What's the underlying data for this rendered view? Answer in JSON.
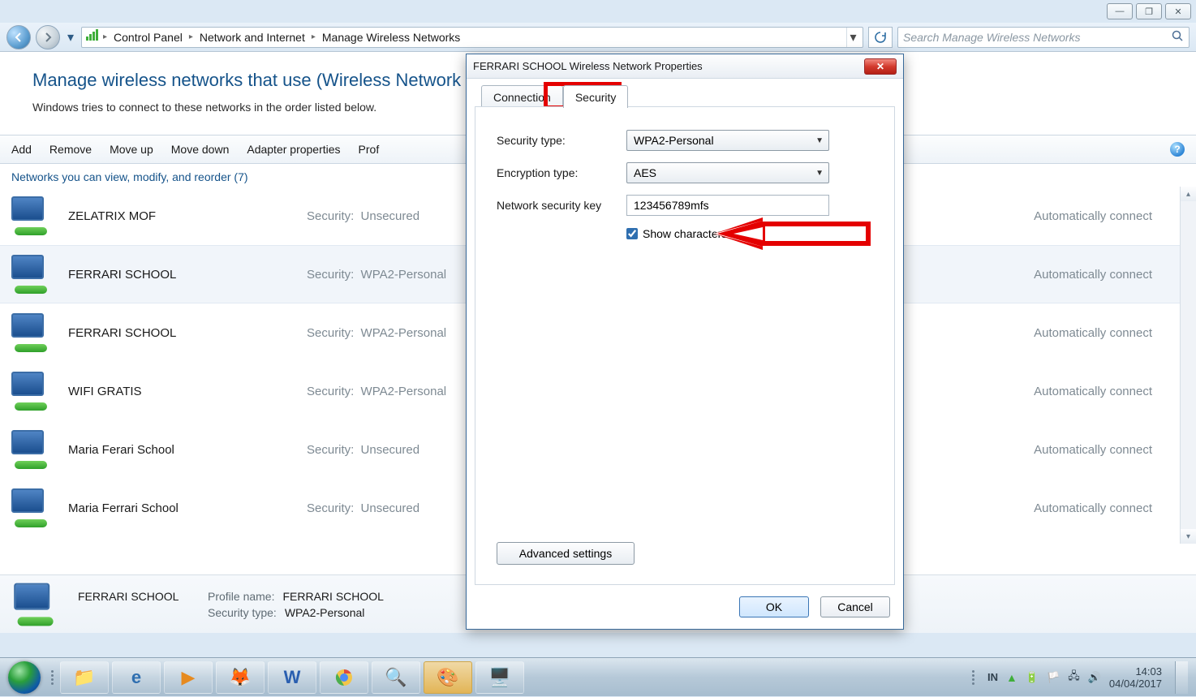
{
  "window_controls": {
    "minimize": "—",
    "maximize": "❐",
    "close": "✕"
  },
  "breadcrumbs": [
    "Control Panel",
    "Network and Internet",
    "Manage Wireless Networks"
  ],
  "search": {
    "placeholder": "Search Manage Wireless Networks"
  },
  "page": {
    "title": "Manage wireless networks that use (Wireless Network",
    "subtitle": "Windows tries to connect to these networks in the order listed below."
  },
  "toolbar": {
    "items": [
      "Add",
      "Remove",
      "Move up",
      "Move down",
      "Adapter properties",
      "Prof"
    ]
  },
  "group_header": "Networks you can view, modify, and reorder (7)",
  "security_label": "Security:",
  "auto_connect_label": "Automatically connect",
  "networks": [
    {
      "name": "ZELATRIX MOF",
      "security": "Unsecured",
      "selected": false
    },
    {
      "name": "FERRARI SCHOOL",
      "security": "WPA2-Personal",
      "selected": true
    },
    {
      "name": "FERRARI SCHOOL",
      "security": "WPA2-Personal",
      "selected": false
    },
    {
      "name": "WIFI GRATIS",
      "security": "WPA2-Personal",
      "selected": false
    },
    {
      "name": "Maria Ferari School",
      "security": "Unsecured",
      "selected": false
    },
    {
      "name": "Maria Ferrari School",
      "security": "Unsecured",
      "selected": false
    }
  ],
  "details": {
    "name": "FERRARI SCHOOL",
    "profile_label": "Profile name:",
    "profile_value": "FERRARI SCHOOL",
    "sectype_label": "Security type:",
    "sectype_value": "WPA2-Personal"
  },
  "dialog": {
    "title": "FERRARI SCHOOL  Wireless Network Properties",
    "tabs": {
      "connection": "Connection",
      "security": "Security"
    },
    "fields": {
      "sectype_label": "Security type:",
      "sectype_value": "WPA2-Personal",
      "enctype_label": "Encryption type:",
      "enctype_value": "AES",
      "key_label": "Network security key",
      "key_value": "123456789mfs",
      "show_chars": "Show characters"
    },
    "advanced": "Advanced settings",
    "ok": "OK",
    "cancel": "Cancel"
  },
  "systray": {
    "lang": "IN",
    "time": "14:03",
    "date": "04/04/2017"
  }
}
